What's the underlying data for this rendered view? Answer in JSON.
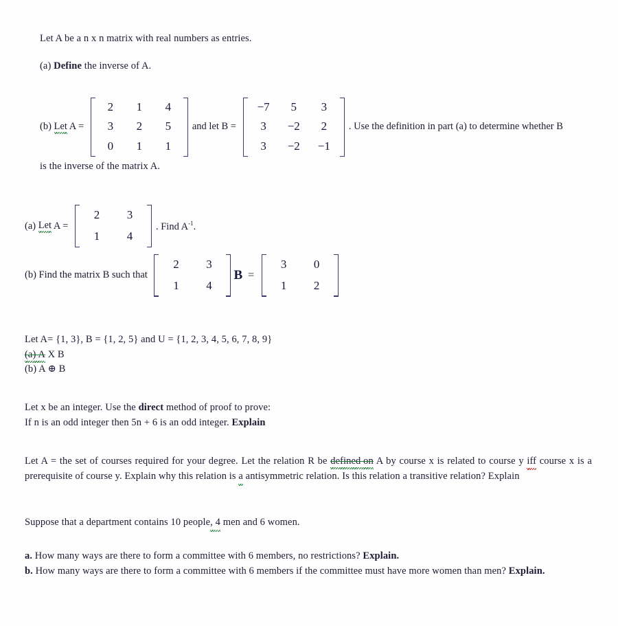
{
  "document": {
    "sections": [
      {
        "id": "matrix-inverse-definition",
        "intro": "Let A be a n x n matrix with real numbers as entries.",
        "intro_squiggle_word": "a",
        "part_a_label": "(a) ",
        "part_a_bold": "Define",
        "part_a_rest": " the inverse of A."
      },
      {
        "id": "verify-inverse-3x3",
        "part_b_label": "(b) ",
        "part_b_squiggle": "Let",
        "part_b_text_1": " A = ",
        "part_b_text_2": "and let B = ",
        "part_b_tail": ". Use the definition in part (a) to determine whether B",
        "closing_line": "is the inverse of the matrix A.",
        "matrix_A": [
          [
            "2",
            "1",
            "4"
          ],
          [
            "3",
            "2",
            "5"
          ],
          [
            "0",
            "1",
            "1"
          ]
        ],
        "matrix_B": [
          [
            "−7",
            "5",
            "3"
          ],
          [
            "3",
            "−2",
            "2"
          ],
          [
            "3",
            "−2",
            "−1"
          ]
        ]
      },
      {
        "id": "find-inverse-2x2",
        "part_a_label": "(a) ",
        "part_a_squiggle": "Let",
        "part_a_text": " A = ",
        "part_a_tail_pre": ". Find A",
        "part_a_tail_sup": "-1",
        "part_a_tail_post": ".",
        "matrix_A": [
          [
            "2",
            "3"
          ],
          [
            "1",
            "4"
          ]
        ],
        "part_b_text": "(b) Find the matrix B such that ",
        "part_b_var": "B",
        "part_b_equals": "=",
        "matrix_left": [
          [
            "2",
            "3"
          ],
          [
            "1",
            "4"
          ]
        ],
        "matrix_right": [
          [
            "3",
            "0"
          ],
          [
            "1",
            "2"
          ]
        ]
      },
      {
        "id": "set-operations",
        "line_1": "Let A= {1, 3}, B = {1, 2, 5} and U = {1, 2, 3, 4, 5, 6, 7, 8, 9}",
        "line_2_struck": "(a) A",
        "line_2_rest": " X B",
        "line_3": "(b) A ⊕ B"
      },
      {
        "id": "direct-proof",
        "line_1_pre": "Let x be an integer.  Use the ",
        "line_1_bold": "direct",
        "line_1_post": " method of proof to prove:",
        "line_2_pre": "If n is an odd integer then 5n + 6 is an odd integer. ",
        "line_2_bold": "Explain"
      },
      {
        "id": "relations",
        "text_1": "Let A = the set of courses required for your degree.  Let the relation R be ",
        "struck_phrase": "defined on",
        "text_2": " A by course x  is related to course y ",
        "squiggle_red": "iff",
        "text_3": " course x is a prerequisite of course y.  Explain why this relation is ",
        "squiggle_green": "a",
        "text_4": " antisymmetric relation.  Is this relation a transitive relation?  Explain"
      },
      {
        "id": "combinatorics",
        "intro_pre": "Suppose that a department contains 10 people",
        "intro_squiggle": ",",
        "intro_sq_num": "4",
        "intro_post": " men and 6 women.",
        "a_bold": "a.",
        "a_text": " How many ways are there to form a committee with 6 members, no restrictions? ",
        "a_tail_bold": "Explain.",
        "b_bold": "b.",
        "b_text": " How many ways are there to form a committee with 6 members if the committee must have more women than men? ",
        "b_tail_bold": "Explain."
      }
    ]
  },
  "colors": {
    "text": "#1b1b33",
    "matrix_bracket": "#3b3b6b",
    "spellcheck_green": "#1d7a34",
    "spellcheck_red": "#cc1111",
    "background": "#ffffff"
  }
}
